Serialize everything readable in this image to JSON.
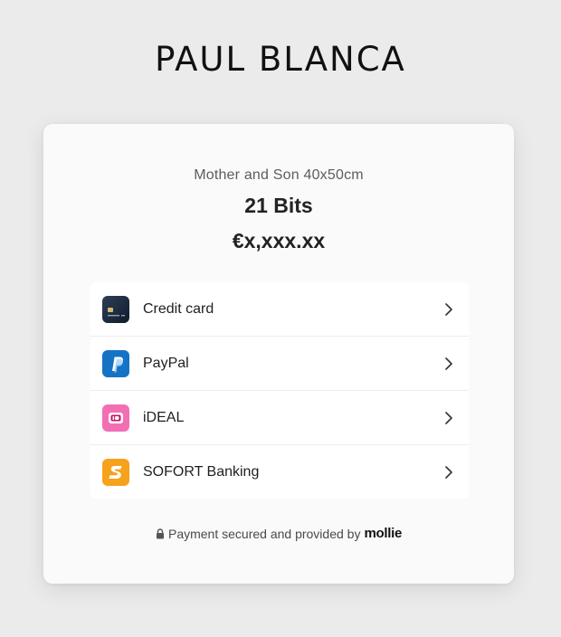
{
  "brand": {
    "name": "PAUL BLANCA"
  },
  "order": {
    "product_name": "Mother and Son 40x50cm",
    "description": "21 Bits",
    "amount": "€x,xxx.xx"
  },
  "payment_methods": [
    {
      "label": "Credit card",
      "icon": "credit-card-icon",
      "color": "#1d2b40"
    },
    {
      "label": "PayPal",
      "icon": "paypal-icon",
      "color": "#1573c6"
    },
    {
      "label": "iDEAL",
      "icon": "ideal-icon",
      "color": "#f26fb4"
    },
    {
      "label": "SOFORT Banking",
      "icon": "sofort-icon",
      "color": "#f7a21b"
    }
  ],
  "footer": {
    "text": "Payment secured and provided by",
    "provider": "mollie",
    "icon": "lock-icon"
  }
}
